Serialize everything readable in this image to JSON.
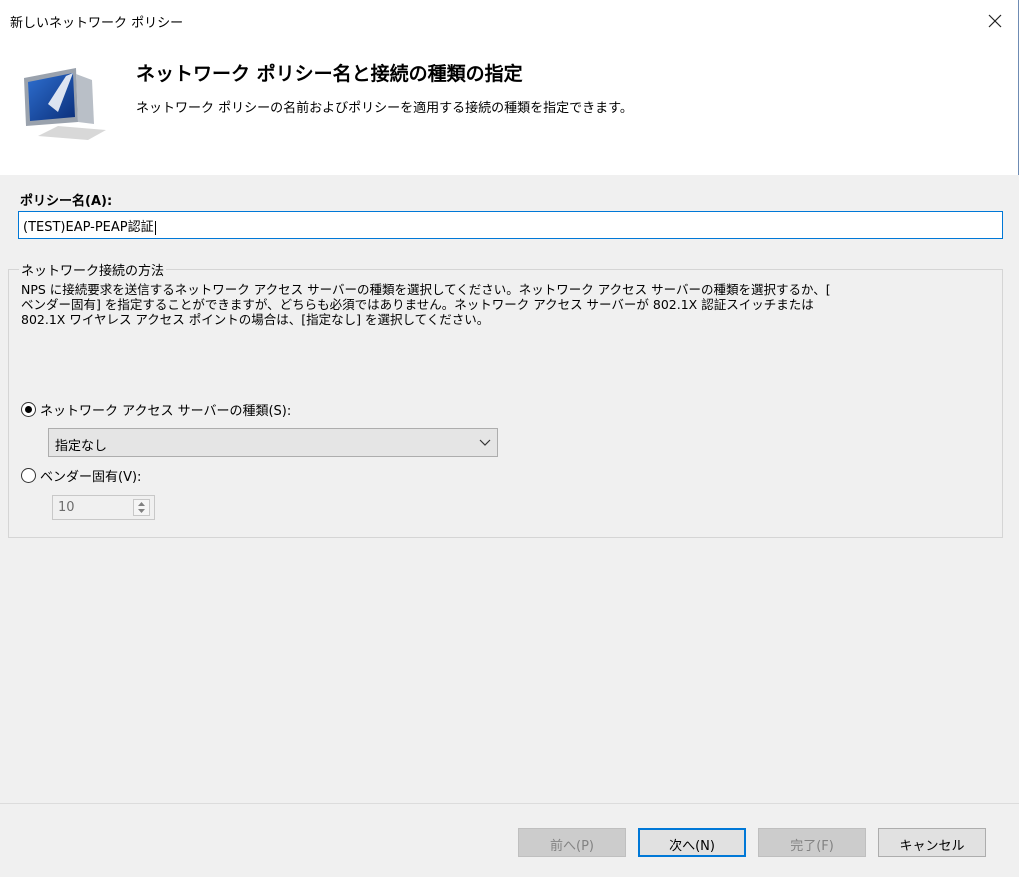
{
  "window": {
    "title": "新しいネットワーク ポリシー",
    "close_icon": "close-icon"
  },
  "header": {
    "title": "ネットワーク ポリシー名と接続の種類の指定",
    "subtitle": "ネットワーク ポリシーの名前およびポリシーを適用する接続の種類を指定できます。",
    "icon": "monitor-icon"
  },
  "policy": {
    "label": "ポリシー名(A):",
    "value": "(TEST)EAP-PEAP認証"
  },
  "connection": {
    "legend": "ネットワーク接続の方法",
    "description": "NPS に接続要求を送信するネットワーク アクセス サーバーの種類を選択してください。ネットワーク アクセス サーバーの種類を選択するか、[\nベンダー固有] を指定することができますが、どちらも必須ではありません。ネットワーク アクセス サーバーが 802.1X 認証スイッチまたは\n802.1X ワイヤレス アクセス ポイントの場合は、[指定なし] を選択してください。",
    "option_type_label": "ネットワーク アクセス サーバーの種類(S):",
    "option_type_selected": true,
    "type_select_value": "指定なし",
    "option_vendor_label": "ベンダー固有(V):",
    "option_vendor_selected": false,
    "vendor_value": "10"
  },
  "buttons": {
    "back": "前へ(P)",
    "next": "次へ(N)",
    "finish": "完了(F)",
    "cancel": "キャンセル"
  }
}
